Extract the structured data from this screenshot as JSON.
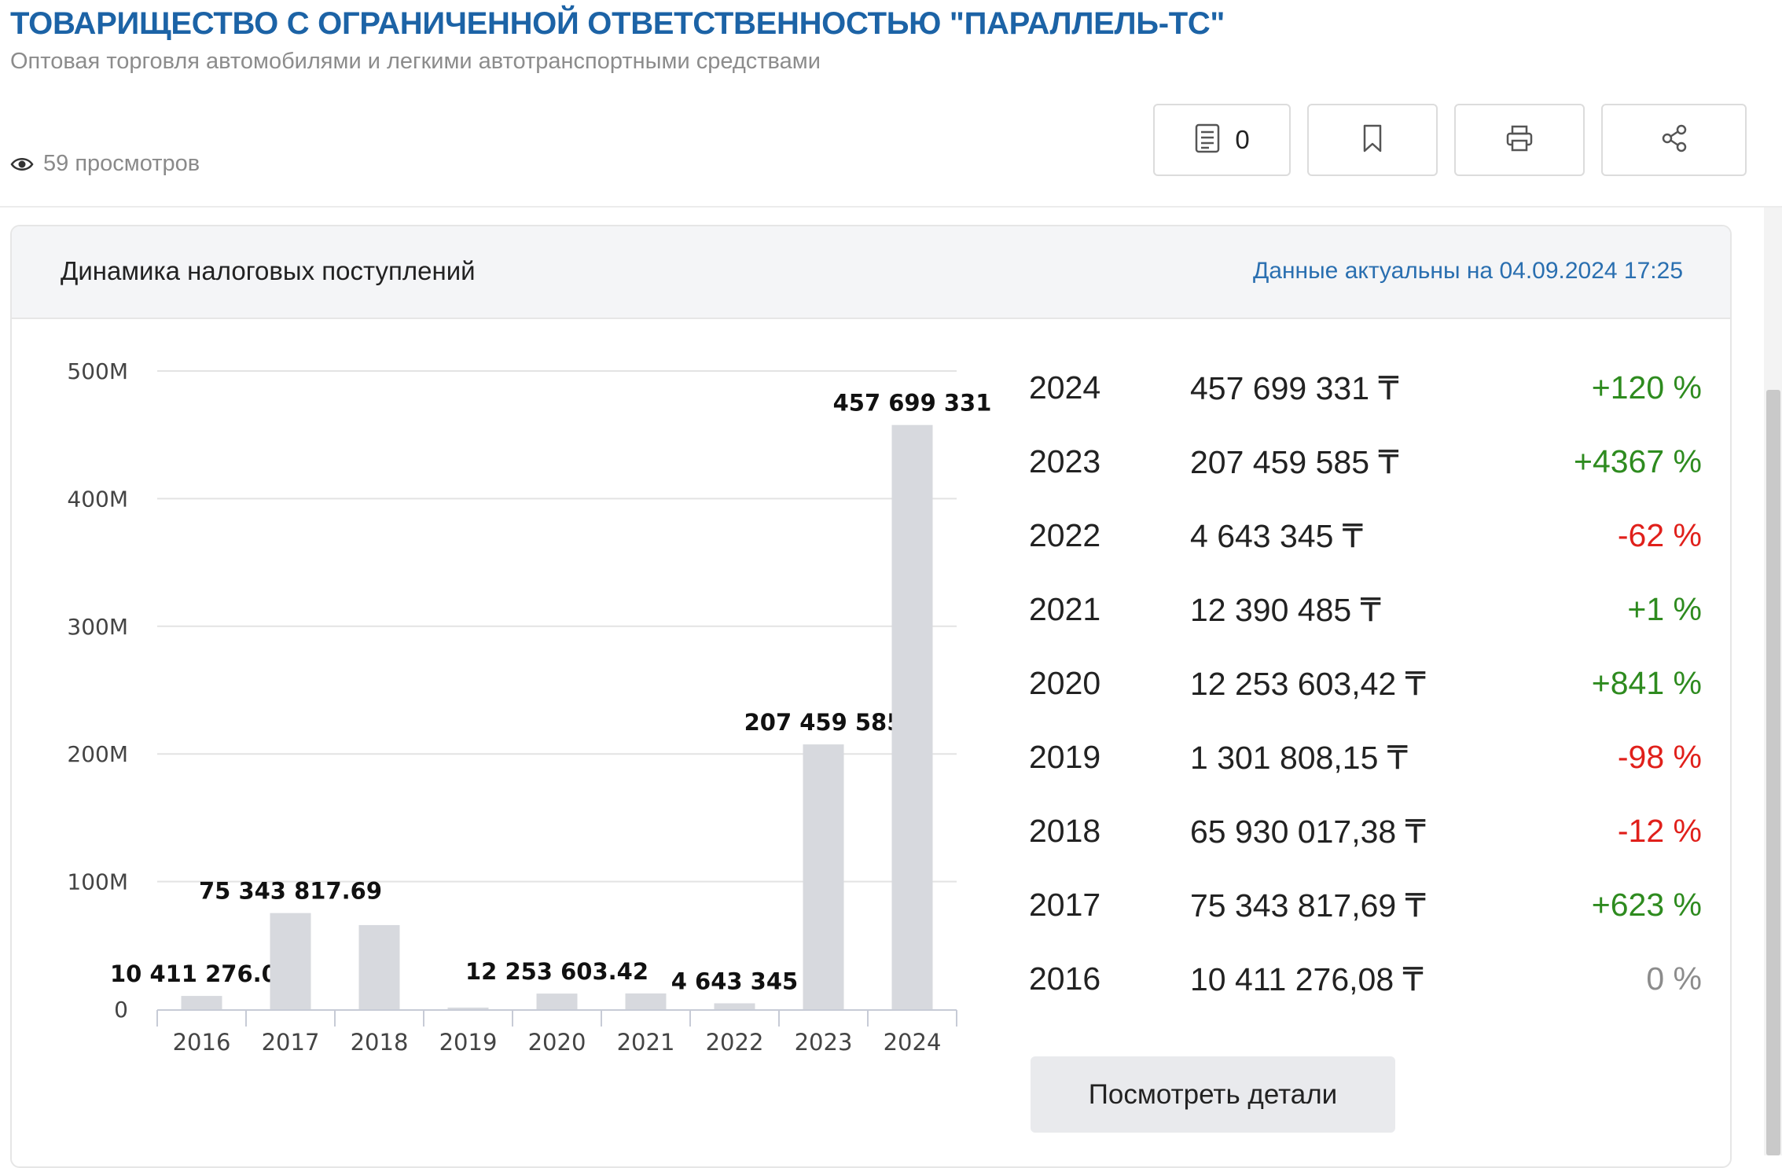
{
  "company": {
    "title": "ТОВАРИЩЕСТВО С ОГРАНИЧЕННОЙ ОТВЕТСТВЕННОСТЬЮ \"ПАРАЛЛЕЛЬ-ТС\"",
    "subtitle": "Оптовая торговля автомобилями и легкими автотранспортными средствами"
  },
  "views": {
    "text": "59 просмотров",
    "icon": "eye-icon"
  },
  "toolbar": {
    "buttons": [
      {
        "name": "documents",
        "icon": "document-icon",
        "count": "0"
      },
      {
        "name": "bookmark",
        "icon": "bookmark-icon"
      },
      {
        "name": "print",
        "icon": "printer-icon"
      },
      {
        "name": "share",
        "icon": "share-icon"
      }
    ]
  },
  "card": {
    "title": "Динамика налоговых поступлений",
    "data_date": "Данные актуальны на 04.09.2024 17:25"
  },
  "chart_data": {
    "type": "bar",
    "categories": [
      "2016",
      "2017",
      "2018",
      "2019",
      "2020",
      "2021",
      "2022",
      "2023",
      "2024"
    ],
    "values": [
      10411276.08,
      75343817.69,
      65930017.38,
      1301808.15,
      12253603.42,
      12390485,
      4643345,
      207459585,
      457699331
    ],
    "data_labels": [
      "10 411 276.08",
      "75 343 817.69",
      "",
      "",
      "12 253 603.42",
      "",
      "4 643 345",
      "207 459 585",
      "457 699 331"
    ],
    "ytick_labels": [
      "0",
      "100M",
      "200M",
      "300M",
      "400M",
      "500M"
    ],
    "yticks": [
      0,
      100000000,
      200000000,
      300000000,
      400000000,
      500000000
    ],
    "ylim": [
      0,
      500000000
    ],
    "grid": true,
    "legend": "none",
    "bar_color": "#d7d9de",
    "title": "",
    "xlabel": "",
    "ylabel": ""
  },
  "tax_table": [
    {
      "year": "2024",
      "amount": "457 699 331 ₸",
      "change": "+120 %",
      "change_color": "#2e8b1f"
    },
    {
      "year": "2023",
      "amount": "207 459 585 ₸",
      "change": "+4367 %",
      "change_color": "#2e8b1f"
    },
    {
      "year": "2022",
      "amount": "4 643 345 ₸",
      "change": "-62 %",
      "change_color": "#e0201b"
    },
    {
      "year": "2021",
      "amount": "12 390 485 ₸",
      "change": "+1 %",
      "change_color": "#2e8b1f"
    },
    {
      "year": "2020",
      "amount": "12 253 603,42 ₸",
      "change": "+841 %",
      "change_color": "#2e8b1f"
    },
    {
      "year": "2019",
      "amount": "1 301 808,15 ₸",
      "change": "-98 %",
      "change_color": "#e0201b"
    },
    {
      "year": "2018",
      "amount": "65 930 017,38 ₸",
      "change": "-12 %",
      "change_color": "#e0201b"
    },
    {
      "year": "2017",
      "amount": "75 343 817,69 ₸",
      "change": "+623 %",
      "change_color": "#2e8b1f"
    },
    {
      "year": "2016",
      "amount": "10 411 276,08 ₸",
      "change": "0 %",
      "change_color": "#8c8c8c"
    }
  ],
  "details_button": {
    "label": "Посмотреть детали"
  }
}
